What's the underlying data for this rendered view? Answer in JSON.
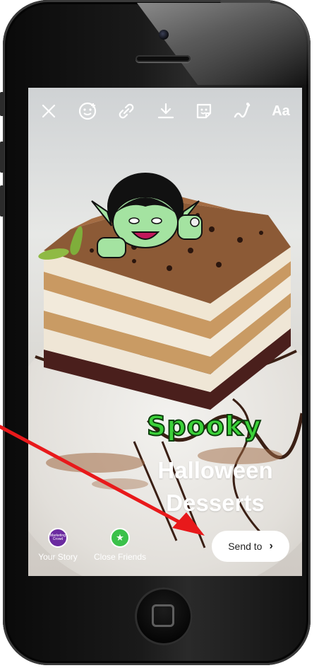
{
  "toolbar": {
    "icons": [
      "close-icon",
      "face-filter-icon",
      "link-icon",
      "download-icon",
      "sticker-icon",
      "draw-icon",
      "text-icon"
    ],
    "text_tool_label": "Aa"
  },
  "story": {
    "sticker_text": "Spooky",
    "headline_line1": "Halloween",
    "headline_line2": "Desserts"
  },
  "bottom_bar": {
    "your_story_label": "Your Story",
    "your_story_avatar_text": "Marketing Crowd",
    "close_friends_label": "Close Friends",
    "send_to_label": "Send to"
  },
  "colors": {
    "annotation_arrow": "#e8191b",
    "close_friends_green": "#3bc14a",
    "spooky_green": "#3cd23a"
  }
}
